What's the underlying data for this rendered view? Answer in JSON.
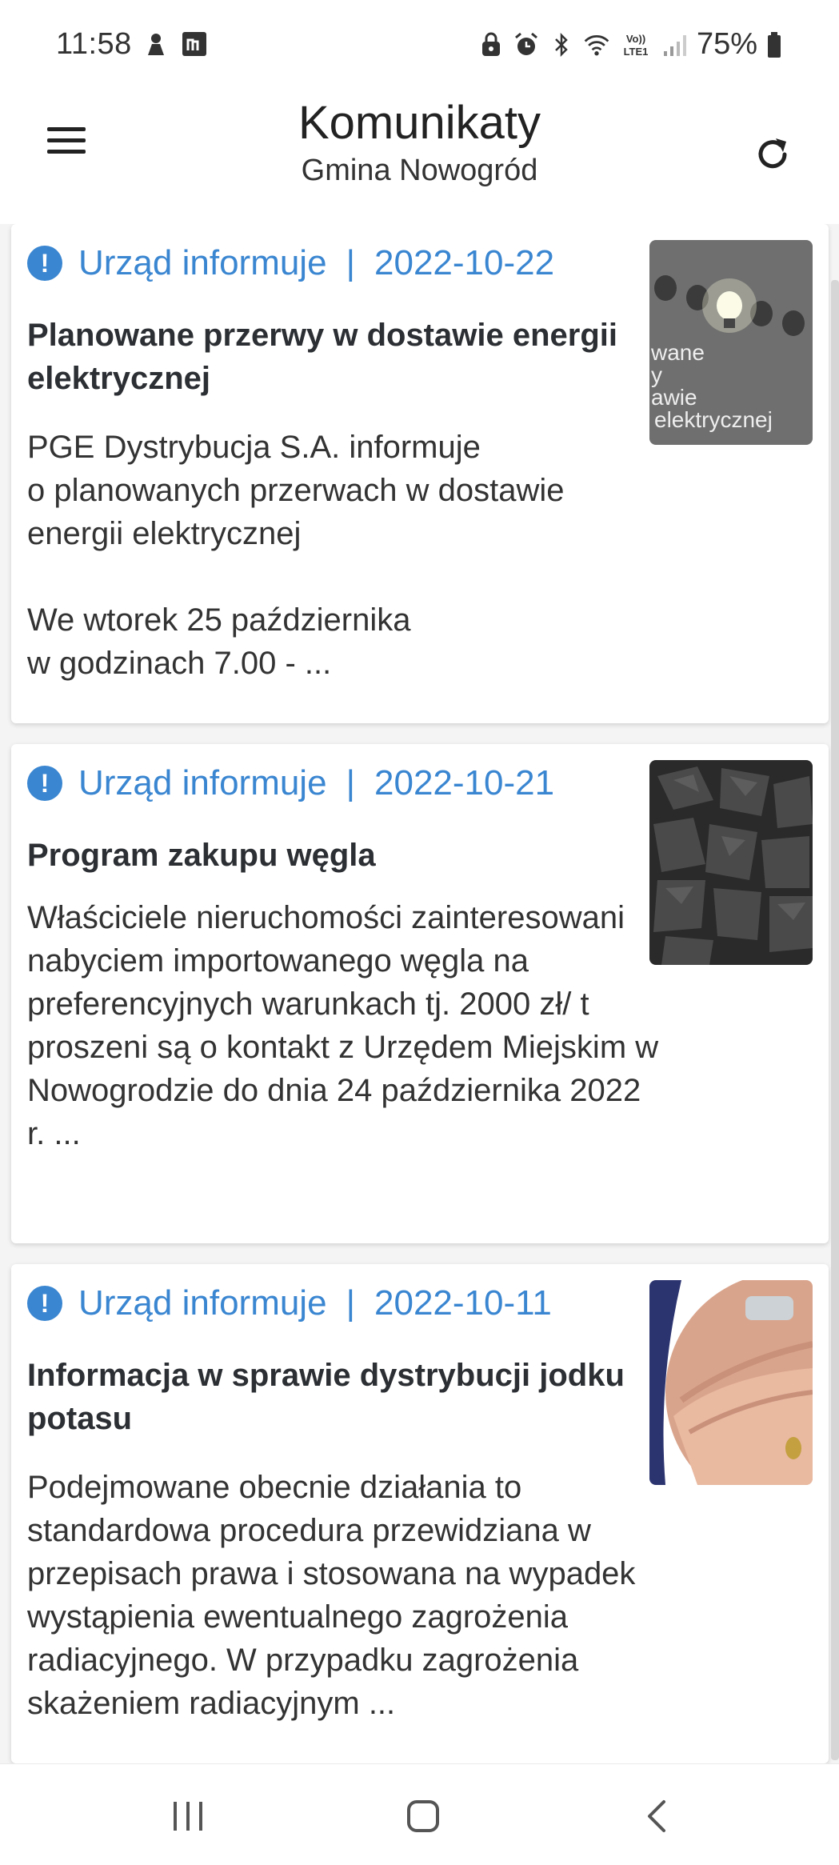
{
  "status_bar": {
    "time": "11:58",
    "battery": "75%",
    "left_icons": [
      "notification-icon",
      "m-app-icon"
    ],
    "right_icons": [
      "lock-icon",
      "alarm-icon",
      "bluetooth-icon",
      "wifi-icon",
      "volte-icon",
      "signal-icon",
      "battery-icon"
    ],
    "volte_label": "Vo)) LTE1"
  },
  "header": {
    "title": "Komunikaty",
    "subtitle": "Gmina Nowogród",
    "menu_icon": "hamburger-icon",
    "refresh_icon": "refresh-icon"
  },
  "colors": {
    "accent": "#3a86d1",
    "text": "#2c2f33",
    "background": "#f4f4f4"
  },
  "news": [
    {
      "category": "Urząd informuje",
      "separator": "|",
      "date": "2022-10-22",
      "title": "Planowane przerwy w dostawie energii elektrycznej",
      "excerpt": "PGE Dystrybucja S.A. informuje\no planowanych przerwach w dostawie energii elektrycznej\n\nWe wtorek 25 października\nw godzinach 7.00 - ...",
      "thumb_caption": "wane\ny\nawie\nelektrycznej"
    },
    {
      "category": "Urząd informuje",
      "separator": "|",
      "date": "2022-10-21",
      "title": "Program zakupu węgla",
      "excerpt": "Właściciele nieruchomości zainteresowani nabyciem importowanego węgla na preferencyjnych warunkach tj. 2000 zł/ t proszeni są o kontakt z Urzędem Miejskim w Nowogrodzie do dnia 24 października 2022 r. ..."
    },
    {
      "category": "Urząd informuje",
      "separator": "|",
      "date": "2022-10-11",
      "title": "Informacja w sprawie dystrybucji jodku potasu",
      "excerpt": "Podejmowane obecnie działania to standardowa procedura przewidziana w przepisach prawa i stosowana na wypadek wystąpienia ewentualnego zagrożenia radiacyjnego. W przypadku zagrożenia skażeniem radiacyjnym ..."
    }
  ],
  "nav_bar": {
    "buttons": [
      "recent-apps-icon",
      "home-icon",
      "back-icon"
    ]
  }
}
